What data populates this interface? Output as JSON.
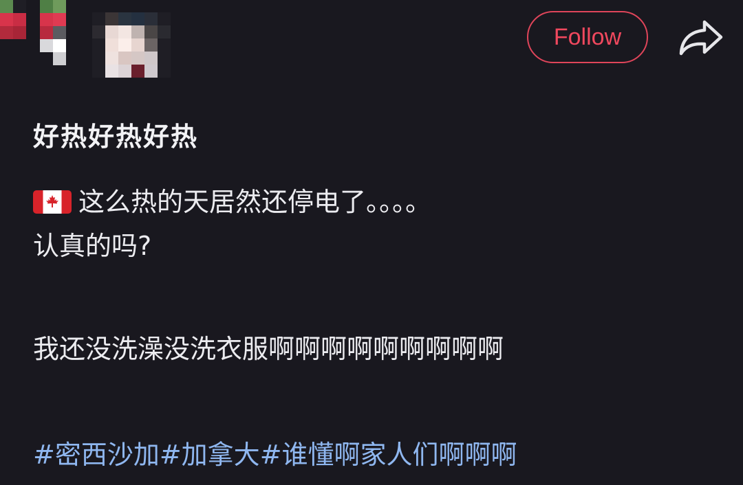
{
  "header": {
    "follow_label": "Follow"
  },
  "post": {
    "title": "好热好热好热",
    "line1": "这么热的天居然还停电了。。。。",
    "line2": "认真的吗?",
    "line3": "我还没洗澡没洗衣服啊啊啊啊啊啊啊啊啊",
    "tags": [
      "#密西沙加",
      "#加拿大",
      "#谁懂啊家人们啊啊啊"
    ]
  },
  "colors": {
    "background": "#19181f",
    "follow_accent": "#e0455a",
    "hashtag": "#8fb7f0"
  },
  "icons": [
    "back-chevron-icon",
    "share-icon",
    "canada-flag-icon"
  ]
}
